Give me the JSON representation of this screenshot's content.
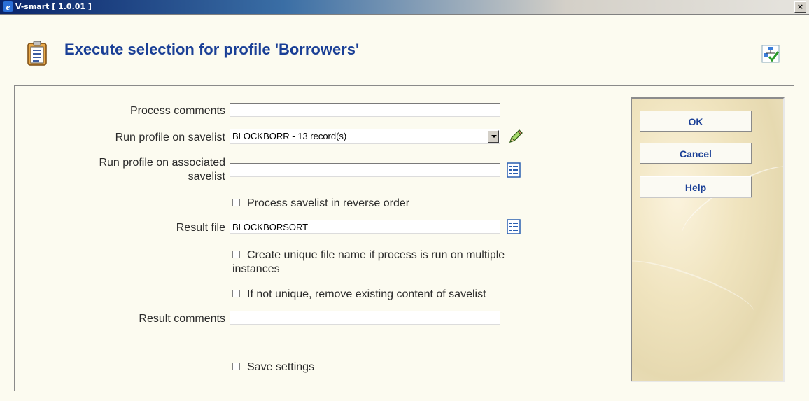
{
  "window": {
    "title": "V-smart [ 1.0.01 ]",
    "close_label": "×"
  },
  "page": {
    "title": "Execute selection for profile 'Borrowers'"
  },
  "form": {
    "process_comments": {
      "label": "Process comments",
      "value": ""
    },
    "savelist": {
      "label": "Run profile on savelist",
      "value": "BLOCKBORR - 13 record(s)"
    },
    "associated_savelist": {
      "label_line1": "Run profile on associated",
      "label_line2": "savelist",
      "value": ""
    },
    "reverse_order": {
      "label": "Process savelist in reverse order",
      "checked": false
    },
    "result_file": {
      "label": "Result file",
      "value": "BLOCKBORSORT"
    },
    "unique_name": {
      "label_line1": "Create unique file name if process is run on multiple",
      "label_line2": "instances",
      "checked": false
    },
    "remove_content": {
      "label": "If not unique, remove existing content of savelist",
      "checked": false
    },
    "result_comments": {
      "label": "Result comments",
      "value": ""
    },
    "save_settings": {
      "label": "Save settings",
      "checked": false
    }
  },
  "buttons": {
    "ok": "OK",
    "cancel": "Cancel",
    "help": "Help"
  },
  "icons": {
    "app": "ie-icon",
    "header": "clipboard-icon",
    "corner": "hierarchy-check-icon",
    "edit": "pencil-icon",
    "list": "list-icon"
  },
  "colors": {
    "title": "#1a3f96",
    "background": "#fcfbf0"
  }
}
